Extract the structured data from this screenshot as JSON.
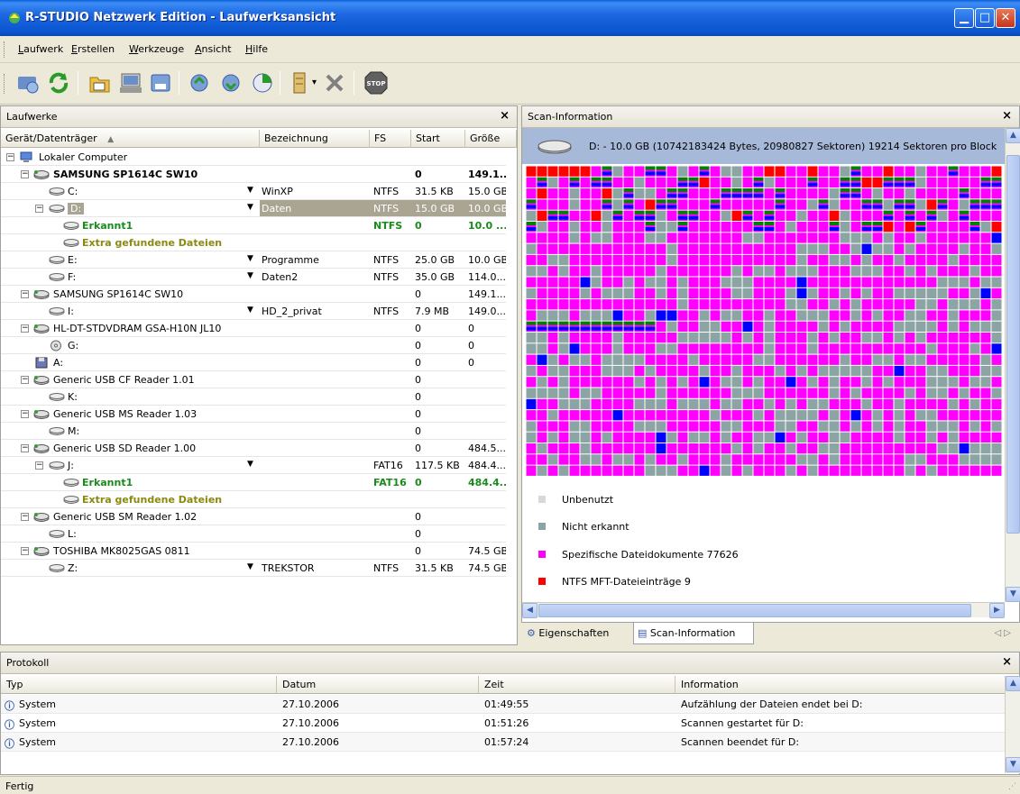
{
  "window": {
    "title": "R-STUDIO Netzwerk Edition - Laufwerksansicht"
  },
  "menu": [
    {
      "label": "Laufwerk",
      "u": "L",
      "rest": "aufwerk"
    },
    {
      "label": "Erstellen",
      "u": "E",
      "rest": "rstellen"
    },
    {
      "label": "Werkzeuge",
      "u": "W",
      "rest": "erkzeuge"
    },
    {
      "label": "Ansicht",
      "u": "A",
      "rest": "nsicht"
    },
    {
      "label": "Hilfe",
      "u": "H",
      "rest": "ilfe"
    }
  ],
  "toolbar": {
    "icons": [
      "connect-drive-icon",
      "refresh-icon",
      "open-image-icon",
      "create-image-icon",
      "scan-icon",
      "recover-icon",
      "region-icon",
      "raid-icon",
      "delete-icon",
      "stop-icon"
    ],
    "stop_label": "STOP"
  },
  "drives": {
    "title": "Laufwerke",
    "close": "×",
    "columns": [
      "Gerät/Datenträger",
      "Bezeichnung",
      "FS",
      "Start",
      "Größe"
    ],
    "sort_arrow": "▲",
    "rows": [
      {
        "name": "Lokaler Computer",
        "label": "",
        "fs": "",
        "start": "",
        "size": ""
      },
      {
        "name": "SAMSUNG SP1614C SW10",
        "label": "",
        "fs": "",
        "start": "0",
        "size": "149.1..."
      },
      {
        "name": "C:",
        "label": "WinXP",
        "fs": "NTFS",
        "start": "31.5 KB",
        "size": "15.0 GB"
      },
      {
        "name": "D:",
        "label": "Daten",
        "fs": "NTFS",
        "start": "15.0 GB",
        "size": "10.0 GB"
      },
      {
        "name": "Erkannt1",
        "label": "",
        "fs": "NTFS",
        "start": "0",
        "size": "10.0 ..."
      },
      {
        "name": "Extra gefundene Dateien",
        "label": "",
        "fs": "",
        "start": "",
        "size": ""
      },
      {
        "name": "E:",
        "label": "Programme",
        "fs": "NTFS",
        "start": "25.0 GB",
        "size": "10.0 GB"
      },
      {
        "name": "F:",
        "label": "Daten2",
        "fs": "NTFS",
        "start": "35.0 GB",
        "size": "114.0..."
      },
      {
        "name": "SAMSUNG SP1614C SW10",
        "label": "",
        "fs": "",
        "start": "0",
        "size": "149.1..."
      },
      {
        "name": "I:",
        "label": "HD_2_privat",
        "fs": "NTFS",
        "start": "7.9 MB",
        "size": "149.0..."
      },
      {
        "name": "HL-DT-STDVDRAM GSA-H10N JL10",
        "label": "",
        "fs": "",
        "start": "0",
        "size": "0"
      },
      {
        "name": "G:",
        "label": "",
        "fs": "",
        "start": "0",
        "size": "0"
      },
      {
        "name": "A:",
        "label": "",
        "fs": "",
        "start": "0",
        "size": "0"
      },
      {
        "name": "Generic USB CF Reader 1.01",
        "label": "",
        "fs": "",
        "start": "0",
        "size": ""
      },
      {
        "name": "K:",
        "label": "",
        "fs": "",
        "start": "0",
        "size": ""
      },
      {
        "name": "Generic USB MS Reader 1.03",
        "label": "",
        "fs": "",
        "start": "0",
        "size": ""
      },
      {
        "name": "M:",
        "label": "",
        "fs": "",
        "start": "0",
        "size": ""
      },
      {
        "name": "Generic USB SD Reader 1.00",
        "label": "",
        "fs": "",
        "start": "0",
        "size": "484.5..."
      },
      {
        "name": "J:",
        "label": "",
        "fs": "FAT16",
        "start": "117.5 KB",
        "size": "484.4..."
      },
      {
        "name": "Erkannt1",
        "label": "",
        "fs": "FAT16",
        "start": "0",
        "size": "484.4..."
      },
      {
        "name": "Extra gefundene Dateien",
        "label": "",
        "fs": "",
        "start": "",
        "size": ""
      },
      {
        "name": "Generic USB SM Reader 1.02",
        "label": "",
        "fs": "",
        "start": "0",
        "size": ""
      },
      {
        "name": "L:",
        "label": "",
        "fs": "",
        "start": "0",
        "size": ""
      },
      {
        "name": "TOSHIBA MK8025GAS 0811",
        "label": "",
        "fs": "",
        "start": "0",
        "size": "74.5 GB"
      },
      {
        "name": "Z:",
        "label": "TREKSTOR",
        "fs": "NTFS",
        "start": "31.5 KB",
        "size": "74.5 GB"
      }
    ]
  },
  "scan": {
    "title": "Scan-Information",
    "close": "×",
    "drive_info": "D: - 10.0 GB (10742183424 Bytes, 20980827 Sektoren) 19214 Sektoren pro Block",
    "legend": [
      {
        "label": "Unbenutzt",
        "color": "#d8d8d8"
      },
      {
        "label": "Nicht erkannt",
        "color": "#8ca4a4"
      },
      {
        "label": "Spezifische Dateidokumente 77626",
        "color": "#ff00ff"
      },
      {
        "label": "NTFS MFT-Dateieinträge 9",
        "color": "#ff0000"
      }
    ],
    "tabs": [
      "Eigenschaften",
      "Scan-Information"
    ],
    "tab_arrows": "◁ ▷"
  },
  "log": {
    "title": "Protokoll",
    "close": "×",
    "columns": [
      "Typ",
      "Datum",
      "Zeit",
      "Information"
    ],
    "rows": [
      {
        "type": "System",
        "date": "27.10.2006",
        "time": "01:49:55",
        "info": "Aufzählung der Dateien endet bei D:"
      },
      {
        "type": "System",
        "date": "27.10.2006",
        "time": "01:51:26",
        "info": "Scannen gestartet für D:"
      },
      {
        "type": "System",
        "date": "27.10.2006",
        "time": "01:57:24",
        "info": "Scannen beendet für D:"
      }
    ]
  },
  "status": {
    "text": "Fertig"
  },
  "colors": {
    "titlebar": "#0c55d0",
    "selection": "#a9a592",
    "green_text": "#1a8a1a",
    "olive_text": "#8a8a10",
    "magenta": "#ff00ff",
    "teal": "#8ca4a4",
    "blue": "#0000ff",
    "green": "#008000",
    "red": "#ff0000"
  }
}
